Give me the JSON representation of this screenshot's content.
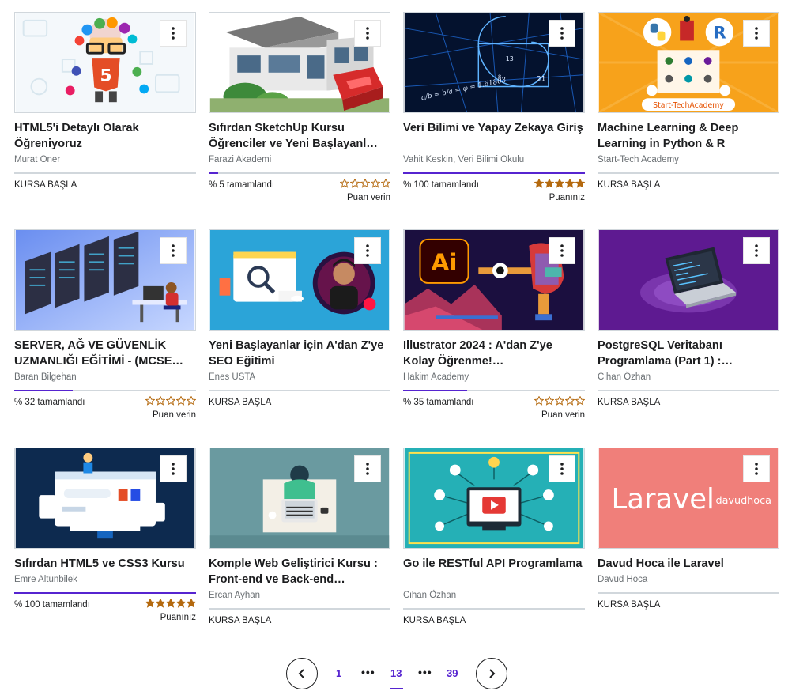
{
  "courses": [
    {
      "title": "HTML5'i Detaylı Olarak Öğreniyoruz",
      "author": "Murat Oner",
      "progress": 0,
      "progress_text": "",
      "start_label": "KURSA BAŞLA",
      "stars": 0,
      "rating_label": ""
    },
    {
      "title": "Sıfırdan SketchUp Kursu Öğrenciler ve Yeni Başlayanl…",
      "author": "Farazi Akademi",
      "progress": 5,
      "progress_text": "% 5 tamamlandı",
      "start_label": "",
      "stars": 0,
      "rating_label": "Puan verin"
    },
    {
      "title": "Veri Bilimi ve Yapay Zekaya Giriş",
      "author": "Vahit Keskin, Veri Bilimi Okulu",
      "progress": 100,
      "progress_text": "% 100 tamamlandı",
      "start_label": "",
      "stars": 5,
      "rating_label": "Puanınız"
    },
    {
      "title": "Machine Learning & Deep Learning in Python & R",
      "author": "Start-Tech Academy",
      "progress": 0,
      "progress_text": "",
      "start_label": "KURSA BAŞLA",
      "stars": 0,
      "rating_label": ""
    },
    {
      "title": "SERVER, AĞ VE GÜVENLİK UZMANLIĞI EĞİTİMİ - (MCSE…",
      "author": "Baran Bilgehan",
      "progress": 32,
      "progress_text": "% 32 tamamlandı",
      "start_label": "",
      "stars": 0,
      "rating_label": "Puan verin"
    },
    {
      "title": "Yeni Başlayanlar için A'dan Z'ye SEO Eğitimi",
      "author": "Enes USTA",
      "progress": 0,
      "progress_text": "",
      "start_label": "KURSA BAŞLA",
      "stars": 0,
      "rating_label": ""
    },
    {
      "title": "Illustrator 2024 : A'dan Z'ye Kolay Öğrenme!…",
      "author": "Hakim Academy",
      "progress": 35,
      "progress_text": "% 35 tamamlandı",
      "start_label": "",
      "stars": 0,
      "rating_label": "Puan verin"
    },
    {
      "title": "PostgreSQL Veritabanı Programlama (Part 1) :…",
      "author": "Cihan Özhan",
      "progress": 0,
      "progress_text": "",
      "start_label": "KURSA BAŞLA",
      "stars": 0,
      "rating_label": ""
    },
    {
      "title": "Sıfırdan HTML5 ve CSS3 Kursu",
      "author": "Emre Altunbilek",
      "progress": 100,
      "progress_text": "% 100 tamamlandı",
      "start_label": "",
      "stars": 5,
      "rating_label": "Puanınız"
    },
    {
      "title": "Komple Web Geliştirici Kursu : Front-end ve Back-end…",
      "author": "Ercan Ayhan",
      "progress": 0,
      "progress_text": "",
      "start_label": "KURSA BAŞLA",
      "stars": 0,
      "rating_label": ""
    },
    {
      "title": "Go ile RESTful API Programlama",
      "author": "Cihan Özhan",
      "progress": 0,
      "progress_text": "",
      "start_label": "KURSA BAŞLA",
      "stars": 0,
      "rating_label": ""
    },
    {
      "title": "Davud Hoca ile Laravel",
      "author": "Davud Hoca",
      "progress": 0,
      "progress_text": "",
      "start_label": "KURSA BAŞLA",
      "stars": 0,
      "rating_label": ""
    }
  ],
  "thumbnails": {
    "ai_logo": "Ai",
    "startech_banner": "Start-TechAcademy",
    "laravel_word": "Laravel",
    "laravel_sub": "davudhoca",
    "r_logo": "R",
    "html5_shield": "5",
    "math_formula": "a/b = b/a = φ = 1.61803"
  },
  "pagination": {
    "first": "1",
    "current": "13",
    "last": "39",
    "dots": "•••"
  },
  "colors": {
    "accent": "#5624d0",
    "star": "#b4690e",
    "text": "#1c1d1f",
    "muted": "#6a6f73",
    "divider": "#d1d7dc"
  }
}
